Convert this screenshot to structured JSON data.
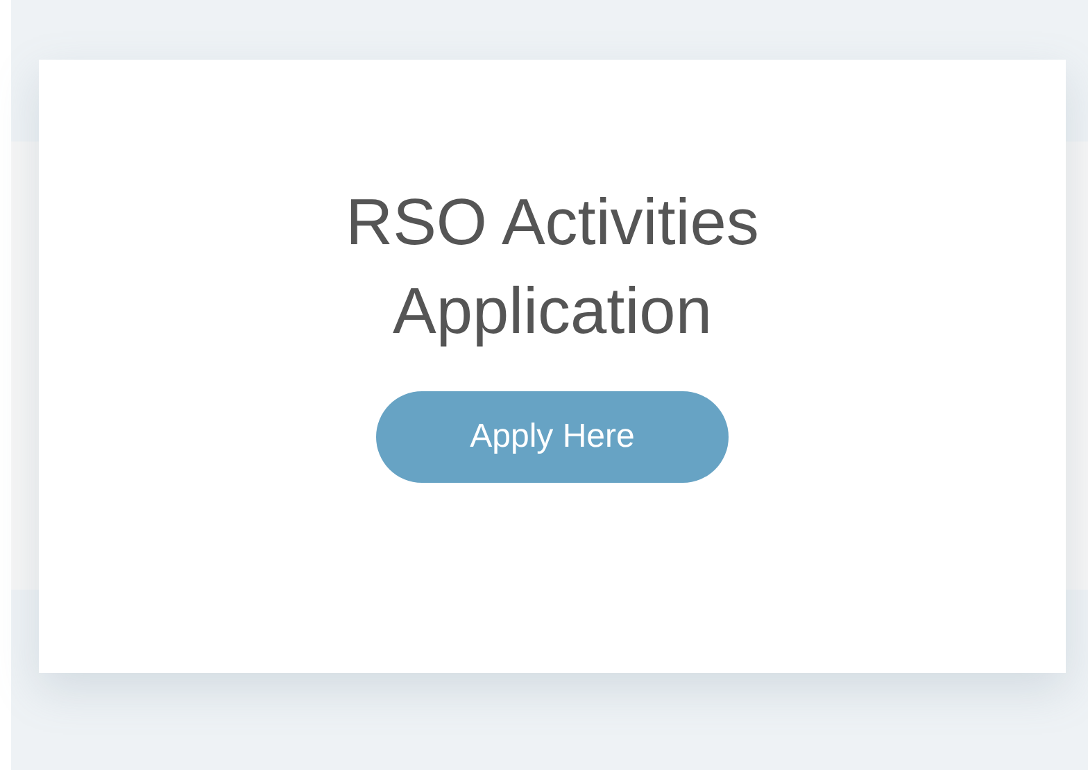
{
  "card": {
    "title": "RSO Activities Application",
    "button": {
      "label": "Apply Here"
    }
  }
}
